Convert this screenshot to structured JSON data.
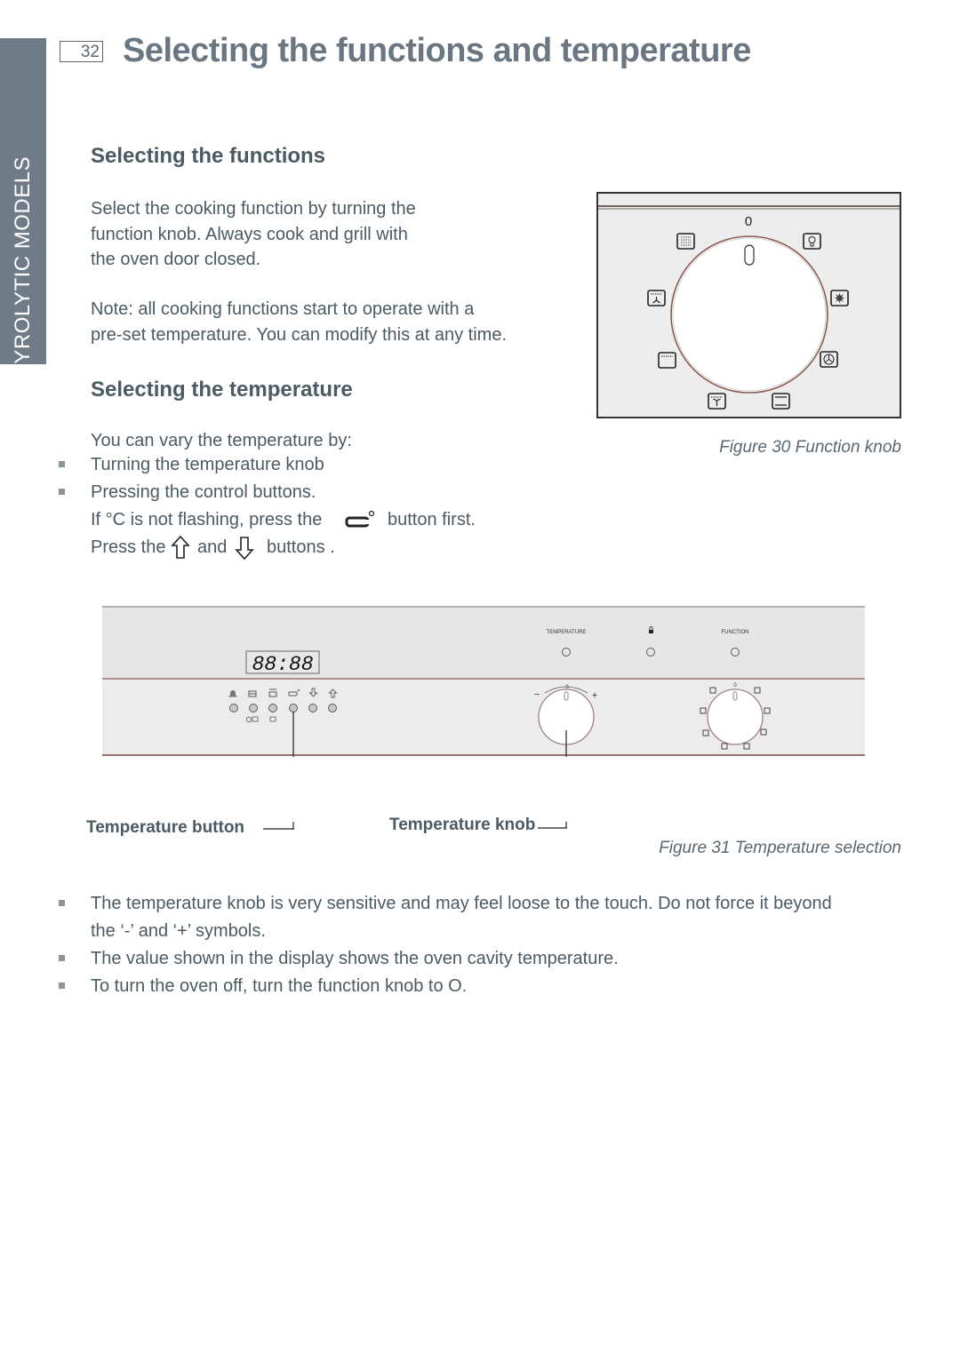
{
  "side_tab": {
    "label": "PYROLYTIC MODELS"
  },
  "header": {
    "page_number": "32",
    "title": "Selecting the functions and temperature"
  },
  "section_functions": {
    "heading": "Selecting the functions",
    "paragraph_lines": [
      "Select the cooking function by turning the",
      "function knob. Always cook and grill with",
      "the oven door closed."
    ],
    "note_lines": [
      "Note: all cooking functions start to operate with a",
      "pre-set temperature. You can modify this at any time."
    ]
  },
  "section_temperature": {
    "heading": "Selecting the temperature",
    "intro": "You can vary the temperature by:",
    "bullets": [
      "Turning the temperature knob",
      "Pressing the control buttons."
    ],
    "line_celsius_pre": "If  °C is not flashing, press the",
    "line_celsius_post": "button first.",
    "line_press_pre": "Press the",
    "line_press_and": "and",
    "line_press_post": "buttons ."
  },
  "figure30": {
    "caption": "Figure 30 Function knob",
    "knob_zero_label": "0",
    "function_icons": [
      "grill-full-icon",
      "light-icon",
      "defrost-icon",
      "fan-forced-icon",
      "bake-icon",
      "fan-grill-icon",
      "conventional-bake-icon",
      "fan-bake-icon"
    ]
  },
  "figure31": {
    "caption": "Figure 31 Temperature selection",
    "display_value": "88:88",
    "panel_labels": {
      "temperature": "TEMPERATURE",
      "function": "FUNCTION"
    },
    "temp_knob_minus": "−",
    "temp_knob_plus": "+",
    "temp_knob_zero": "0",
    "function_knob_zero": "0",
    "control_buttons": [
      "bell",
      "cook-time",
      "stop",
      "temperature",
      "down-arrow",
      "up-arrow"
    ],
    "callouts": {
      "button": "Temperature button",
      "knob": "Temperature knob"
    }
  },
  "notes": {
    "bullets": [
      [
        "The temperature knob is very sensitive and may feel loose to the touch. Do not force it beyond",
        "the ‘-’ and ‘+’  symbols."
      ],
      [
        "The value shown in the display shows the oven cavity temperature."
      ],
      [
        "To turn the oven off, turn the function knob to O."
      ]
    ]
  },
  "colors": {
    "side_tab": "#6f7b86",
    "title": "#6a7782",
    "text": "#4b5a63",
    "panel": "#e8e8e8",
    "knob_ring": "#9a6a6a"
  }
}
